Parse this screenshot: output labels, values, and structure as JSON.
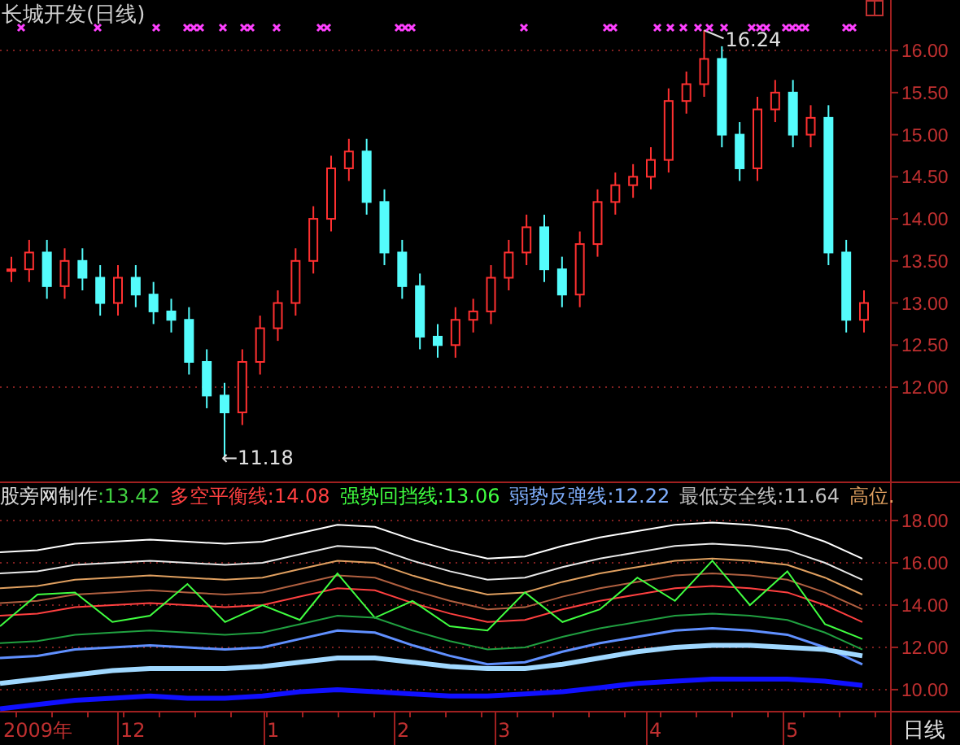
{
  "main_chart": {
    "title": "长城开发(日线)",
    "high_label": "16.24",
    "low_label": "←11.18",
    "chart_data": {
      "type": "candlestick",
      "ohlc": [
        [
          13.4,
          13.55,
          13.25,
          13.4
        ],
        [
          13.4,
          13.75,
          13.25,
          13.6
        ],
        [
          13.6,
          13.75,
          13.05,
          13.2
        ],
        [
          13.2,
          13.65,
          13.05,
          13.5
        ],
        [
          13.5,
          13.65,
          13.15,
          13.3
        ],
        [
          13.3,
          13.45,
          12.85,
          13.0
        ],
        [
          13.0,
          13.45,
          12.85,
          13.3
        ],
        [
          13.3,
          13.45,
          12.95,
          13.1
        ],
        [
          13.1,
          13.25,
          12.75,
          12.9
        ],
        [
          12.9,
          13.05,
          12.65,
          12.8
        ],
        [
          12.8,
          12.95,
          12.15,
          12.3
        ],
        [
          12.3,
          12.45,
          11.75,
          11.9
        ],
        [
          11.9,
          12.05,
          11.18,
          11.7
        ],
        [
          11.7,
          12.45,
          11.55,
          12.3
        ],
        [
          12.3,
          12.85,
          12.15,
          12.7
        ],
        [
          12.7,
          13.15,
          12.55,
          13.0
        ],
        [
          13.0,
          13.65,
          12.85,
          13.5
        ],
        [
          13.5,
          14.15,
          13.35,
          14.0
        ],
        [
          14.0,
          14.75,
          13.85,
          14.6
        ],
        [
          14.6,
          14.95,
          14.45,
          14.8
        ],
        [
          14.8,
          14.95,
          14.05,
          14.2
        ],
        [
          14.2,
          14.35,
          13.45,
          13.6
        ],
        [
          13.6,
          13.75,
          13.05,
          13.2
        ],
        [
          13.2,
          13.35,
          12.45,
          12.6
        ],
        [
          12.6,
          12.75,
          12.35,
          12.5
        ],
        [
          12.5,
          12.95,
          12.35,
          12.8
        ],
        [
          12.8,
          13.05,
          12.65,
          12.9
        ],
        [
          12.9,
          13.45,
          12.75,
          13.3
        ],
        [
          13.3,
          13.75,
          13.15,
          13.6
        ],
        [
          13.6,
          14.05,
          13.45,
          13.9
        ],
        [
          13.9,
          14.05,
          13.25,
          13.4
        ],
        [
          13.4,
          13.55,
          12.95,
          13.1
        ],
        [
          13.1,
          13.85,
          12.95,
          13.7
        ],
        [
          13.7,
          14.35,
          13.55,
          14.2
        ],
        [
          14.2,
          14.55,
          14.05,
          14.4
        ],
        [
          14.4,
          14.65,
          14.25,
          14.5
        ],
        [
          14.5,
          14.85,
          14.35,
          14.7
        ],
        [
          14.7,
          15.55,
          14.55,
          15.4
        ],
        [
          15.4,
          15.75,
          15.25,
          15.6
        ],
        [
          15.6,
          16.24,
          15.45,
          15.9
        ],
        [
          15.9,
          16.05,
          14.85,
          15.0
        ],
        [
          15.0,
          15.15,
          14.45,
          14.6
        ],
        [
          14.6,
          15.45,
          14.45,
          15.3
        ],
        [
          15.3,
          15.65,
          15.15,
          15.5
        ],
        [
          15.5,
          15.65,
          14.85,
          15.0
        ],
        [
          15.0,
          15.35,
          14.85,
          15.2
        ],
        [
          15.2,
          15.35,
          13.45,
          13.6
        ],
        [
          13.6,
          13.75,
          12.65,
          12.8
        ],
        [
          12.8,
          13.15,
          12.65,
          13.0
        ]
      ],
      "ylim": [
        10.86,
        16.6
      ],
      "yticks": [
        {
          "value": 12,
          "label": "12.00"
        },
        {
          "value": 12.5,
          "label": "12.50"
        },
        {
          "value": 13,
          "label": "13.00"
        },
        {
          "value": 13.5,
          "label": "13.50"
        },
        {
          "value": 14,
          "label": "14.00"
        },
        {
          "value": 14.5,
          "label": "14.50"
        },
        {
          "value": 15,
          "label": "15.00"
        },
        {
          "value": 15.5,
          "label": "15.50"
        },
        {
          "value": 16,
          "label": "16.00"
        }
      ]
    }
  },
  "indicator": {
    "name": "股旁网制作",
    "legend": [
      {
        "text": ":13.42",
        "color": "#40d040"
      },
      {
        "text": "多空平衡线:14.08",
        "color": "#ff4040"
      },
      {
        "text": "强势回挡线:13.06",
        "color": "#40ff40"
      },
      {
        "text": "弱势反弹线:12.22",
        "color": "#80b0ff"
      },
      {
        "text": "最低安全线:11.64",
        "color": "#c0c0c0"
      },
      {
        "text": "高位.",
        "color": "#e0a060"
      }
    ],
    "chart_data": {
      "type": "line",
      "series": [
        {
          "color": "#ffffff",
          "values": [
            16.5,
            16.6,
            16.9,
            17.0,
            17.1,
            17.0,
            16.9,
            17.0,
            17.4,
            17.8,
            17.7,
            17.1,
            16.6,
            16.2,
            16.3,
            16.8,
            17.2,
            17.5,
            17.8,
            17.9,
            17.8,
            17.6,
            17.0,
            16.2
          ]
        },
        {
          "color": "#e8e8e8",
          "values": [
            15.5,
            15.6,
            15.9,
            16.0,
            16.1,
            16.0,
            15.9,
            16.0,
            16.4,
            16.8,
            16.7,
            16.1,
            15.6,
            15.2,
            15.3,
            15.8,
            16.2,
            16.5,
            16.8,
            16.9,
            16.8,
            16.6,
            16.0,
            15.2
          ]
        },
        {
          "color": "#e0a060",
          "values": [
            14.8,
            14.9,
            15.2,
            15.3,
            15.4,
            15.3,
            15.2,
            15.3,
            15.7,
            16.1,
            16.0,
            15.4,
            14.9,
            14.5,
            14.6,
            15.1,
            15.5,
            15.8,
            16.1,
            16.2,
            16.1,
            15.9,
            15.3,
            14.5
          ]
        },
        {
          "color": "#b06040",
          "values": [
            14.1,
            14.2,
            14.5,
            14.6,
            14.7,
            14.6,
            14.5,
            14.6,
            15.0,
            15.4,
            15.3,
            14.7,
            14.2,
            13.8,
            13.9,
            14.4,
            14.8,
            15.1,
            15.4,
            15.5,
            15.4,
            15.2,
            14.6,
            13.8
          ]
        },
        {
          "color": "#ff4040",
          "values": [
            13.5,
            13.6,
            13.9,
            14.0,
            14.1,
            14.0,
            13.9,
            14.0,
            14.4,
            14.8,
            14.7,
            14.1,
            13.6,
            13.2,
            13.3,
            13.8,
            14.2,
            14.5,
            14.8,
            14.9,
            14.8,
            14.6,
            14.0,
            13.2
          ]
        },
        {
          "color": "#40ff40",
          "values": [
            13.0,
            14.5,
            14.6,
            13.2,
            13.5,
            15.0,
            13.2,
            14.0,
            13.3,
            15.5,
            13.4,
            14.2,
            13.0,
            12.8,
            14.6,
            13.2,
            13.8,
            15.3,
            14.2,
            16.1,
            14.0,
            15.6,
            13.1,
            12.4
          ]
        },
        {
          "color": "#20a040",
          "values": [
            12.2,
            12.3,
            12.6,
            12.7,
            12.8,
            12.7,
            12.6,
            12.7,
            13.1,
            13.5,
            13.4,
            12.8,
            12.3,
            11.9,
            12.0,
            12.5,
            12.9,
            13.2,
            13.5,
            13.6,
            13.5,
            13.3,
            12.7,
            11.9
          ]
        },
        {
          "color": "#6090ff",
          "values": [
            11.5,
            11.6,
            11.9,
            12.0,
            12.1,
            12.0,
            11.9,
            12.0,
            12.4,
            12.8,
            12.7,
            12.1,
            11.6,
            11.2,
            11.3,
            11.8,
            12.2,
            12.5,
            12.8,
            12.9,
            12.8,
            12.6,
            12.0,
            11.2
          ]
        },
        {
          "color": "#a0d8ff",
          "values": [
            10.3,
            10.5,
            10.7,
            10.9,
            11.0,
            11.0,
            11.0,
            11.1,
            11.3,
            11.5,
            11.5,
            11.3,
            11.1,
            11.0,
            11.0,
            11.2,
            11.5,
            11.8,
            12.0,
            12.1,
            12.1,
            12.0,
            11.9,
            11.6
          ]
        },
        {
          "color": "#1010ff",
          "values": [
            9.1,
            9.3,
            9.5,
            9.6,
            9.7,
            9.6,
            9.6,
            9.7,
            9.9,
            10.0,
            9.9,
            9.8,
            9.7,
            9.7,
            9.8,
            9.9,
            10.1,
            10.3,
            10.4,
            10.5,
            10.5,
            10.5,
            10.4,
            10.2
          ]
        }
      ],
      "ylim": [
        8.92,
        19.77
      ],
      "grid": true,
      "yticks": [
        {
          "value": 10,
          "label": "10.00"
        },
        {
          "value": 12,
          "label": "12.00"
        },
        {
          "value": 14,
          "label": "14.00"
        },
        {
          "value": 16,
          "label": "16.00"
        },
        {
          "value": 18,
          "label": "18.00"
        }
      ]
    }
  },
  "time_axis": {
    "labels": [
      "2009年",
      "12",
      "1",
      "2",
      "3",
      "4",
      "5"
    ],
    "period": "日线"
  }
}
